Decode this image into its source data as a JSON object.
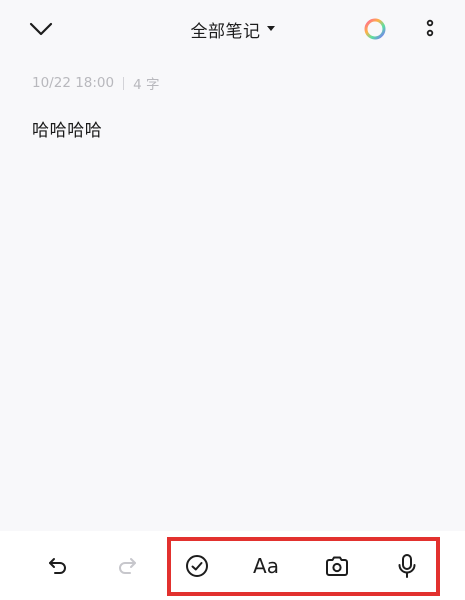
{
  "header": {
    "notebook_title": "全部笔记",
    "icons": {
      "collapse": "chevron-down-icon",
      "dropdown": "caret-down-icon",
      "theme": "color-ring-icon",
      "more": "more-vertical-icon"
    }
  },
  "note": {
    "date": "10/22 18:00",
    "char_count": "4 字",
    "content": "哈哈哈哈"
  },
  "toolbar": {
    "format_label": "Aa",
    "icons": [
      "undo-icon",
      "redo-icon",
      "checklist-icon",
      "text-format-icon",
      "camera-icon",
      "microphone-icon"
    ],
    "redo_enabled": false
  },
  "colors": {
    "background": "#f8f8fa",
    "toolbar_background": "#ffffff",
    "highlight": "#e2312e",
    "meta_text": "#b8b8bd",
    "disabled_icon": "#c7c7cc"
  }
}
